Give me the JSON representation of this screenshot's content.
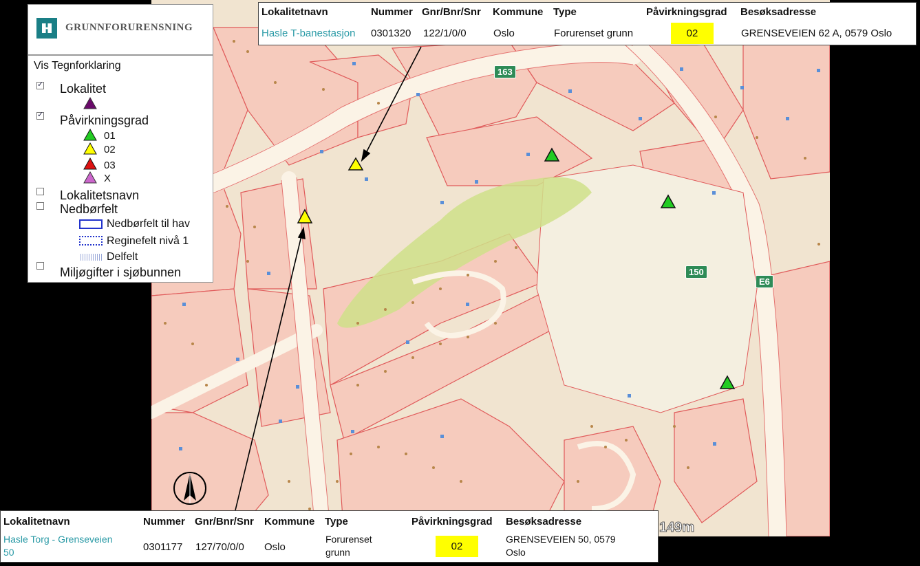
{
  "brand": {
    "name": "GRUNNFORURENSNING",
    "logo_color": "#1a7f86"
  },
  "legend": {
    "title": "Vis Tegnforklaring",
    "lokalitet": {
      "label": "Lokalitet",
      "checked": true,
      "color": "#6a0a6a"
    },
    "pavirkningsgrad": {
      "label": "Påvirkningsgrad",
      "checked": true,
      "items": [
        {
          "label": "01",
          "color": "#22cc22"
        },
        {
          "label": "02",
          "color": "#ffff00"
        },
        {
          "label": "03",
          "color": "#dd1111"
        },
        {
          "label": "X",
          "color": "#cc66cc"
        }
      ]
    },
    "lokalitetsnavn": {
      "label": "Lokalitetsnavn",
      "checked": false
    },
    "nedborfelt": {
      "label": "Nedbørfelt",
      "checked": false,
      "items": [
        {
          "label": "Nedbørfelt til hav"
        },
        {
          "label": "Reginefelt nivå 1"
        },
        {
          "label": "Delfelt"
        }
      ]
    },
    "miljogifter": {
      "label": "Miljøgifter i sjøbunnen",
      "checked": false
    }
  },
  "table_headers": [
    "Lokalitetnavn",
    "Nummer",
    "Gnr/Bnr/Snr",
    "Kommune",
    "Type",
    "Påvirkningsgrad",
    "Besøksadresse"
  ],
  "top_box": {
    "name": "Hasle T-banestasjon",
    "nummer": "0301320",
    "gnr": "122/1/0/0",
    "kommune": "Oslo",
    "type": "Forurenset grunn",
    "grad": "02",
    "adresse": "GRENSEVEIEN 62 A, 0579 Oslo"
  },
  "bottom_box": {
    "name_line1": "Hasle Torg - Grenseveien",
    "name_line2": "50",
    "nummer": "0301177",
    "gnr": "127/70/0/0",
    "kommune": "Oslo",
    "type_line1": "Forurenset",
    "type_line2": "grunn",
    "grad": "02",
    "adresse_line1": "GRENSEVEIEN 50, 0579",
    "adresse_line2": "Oslo"
  },
  "map": {
    "road_labels": [
      "163",
      "150",
      "E6"
    ],
    "scale_label": "149m",
    "markers": [
      {
        "grade": "02"
      },
      {
        "grade": "02"
      },
      {
        "grade": "01"
      },
      {
        "grade": "01"
      },
      {
        "grade": "01"
      }
    ]
  },
  "colors": {
    "grade_01": "#22cc22",
    "grade_02": "#ffff00",
    "parcel_line": "#e05a5a",
    "parcel_fill": "#f5c6bd",
    "road": "#fdf5ea",
    "green_area": "#cfe08a",
    "link": "#2a9aa6"
  }
}
